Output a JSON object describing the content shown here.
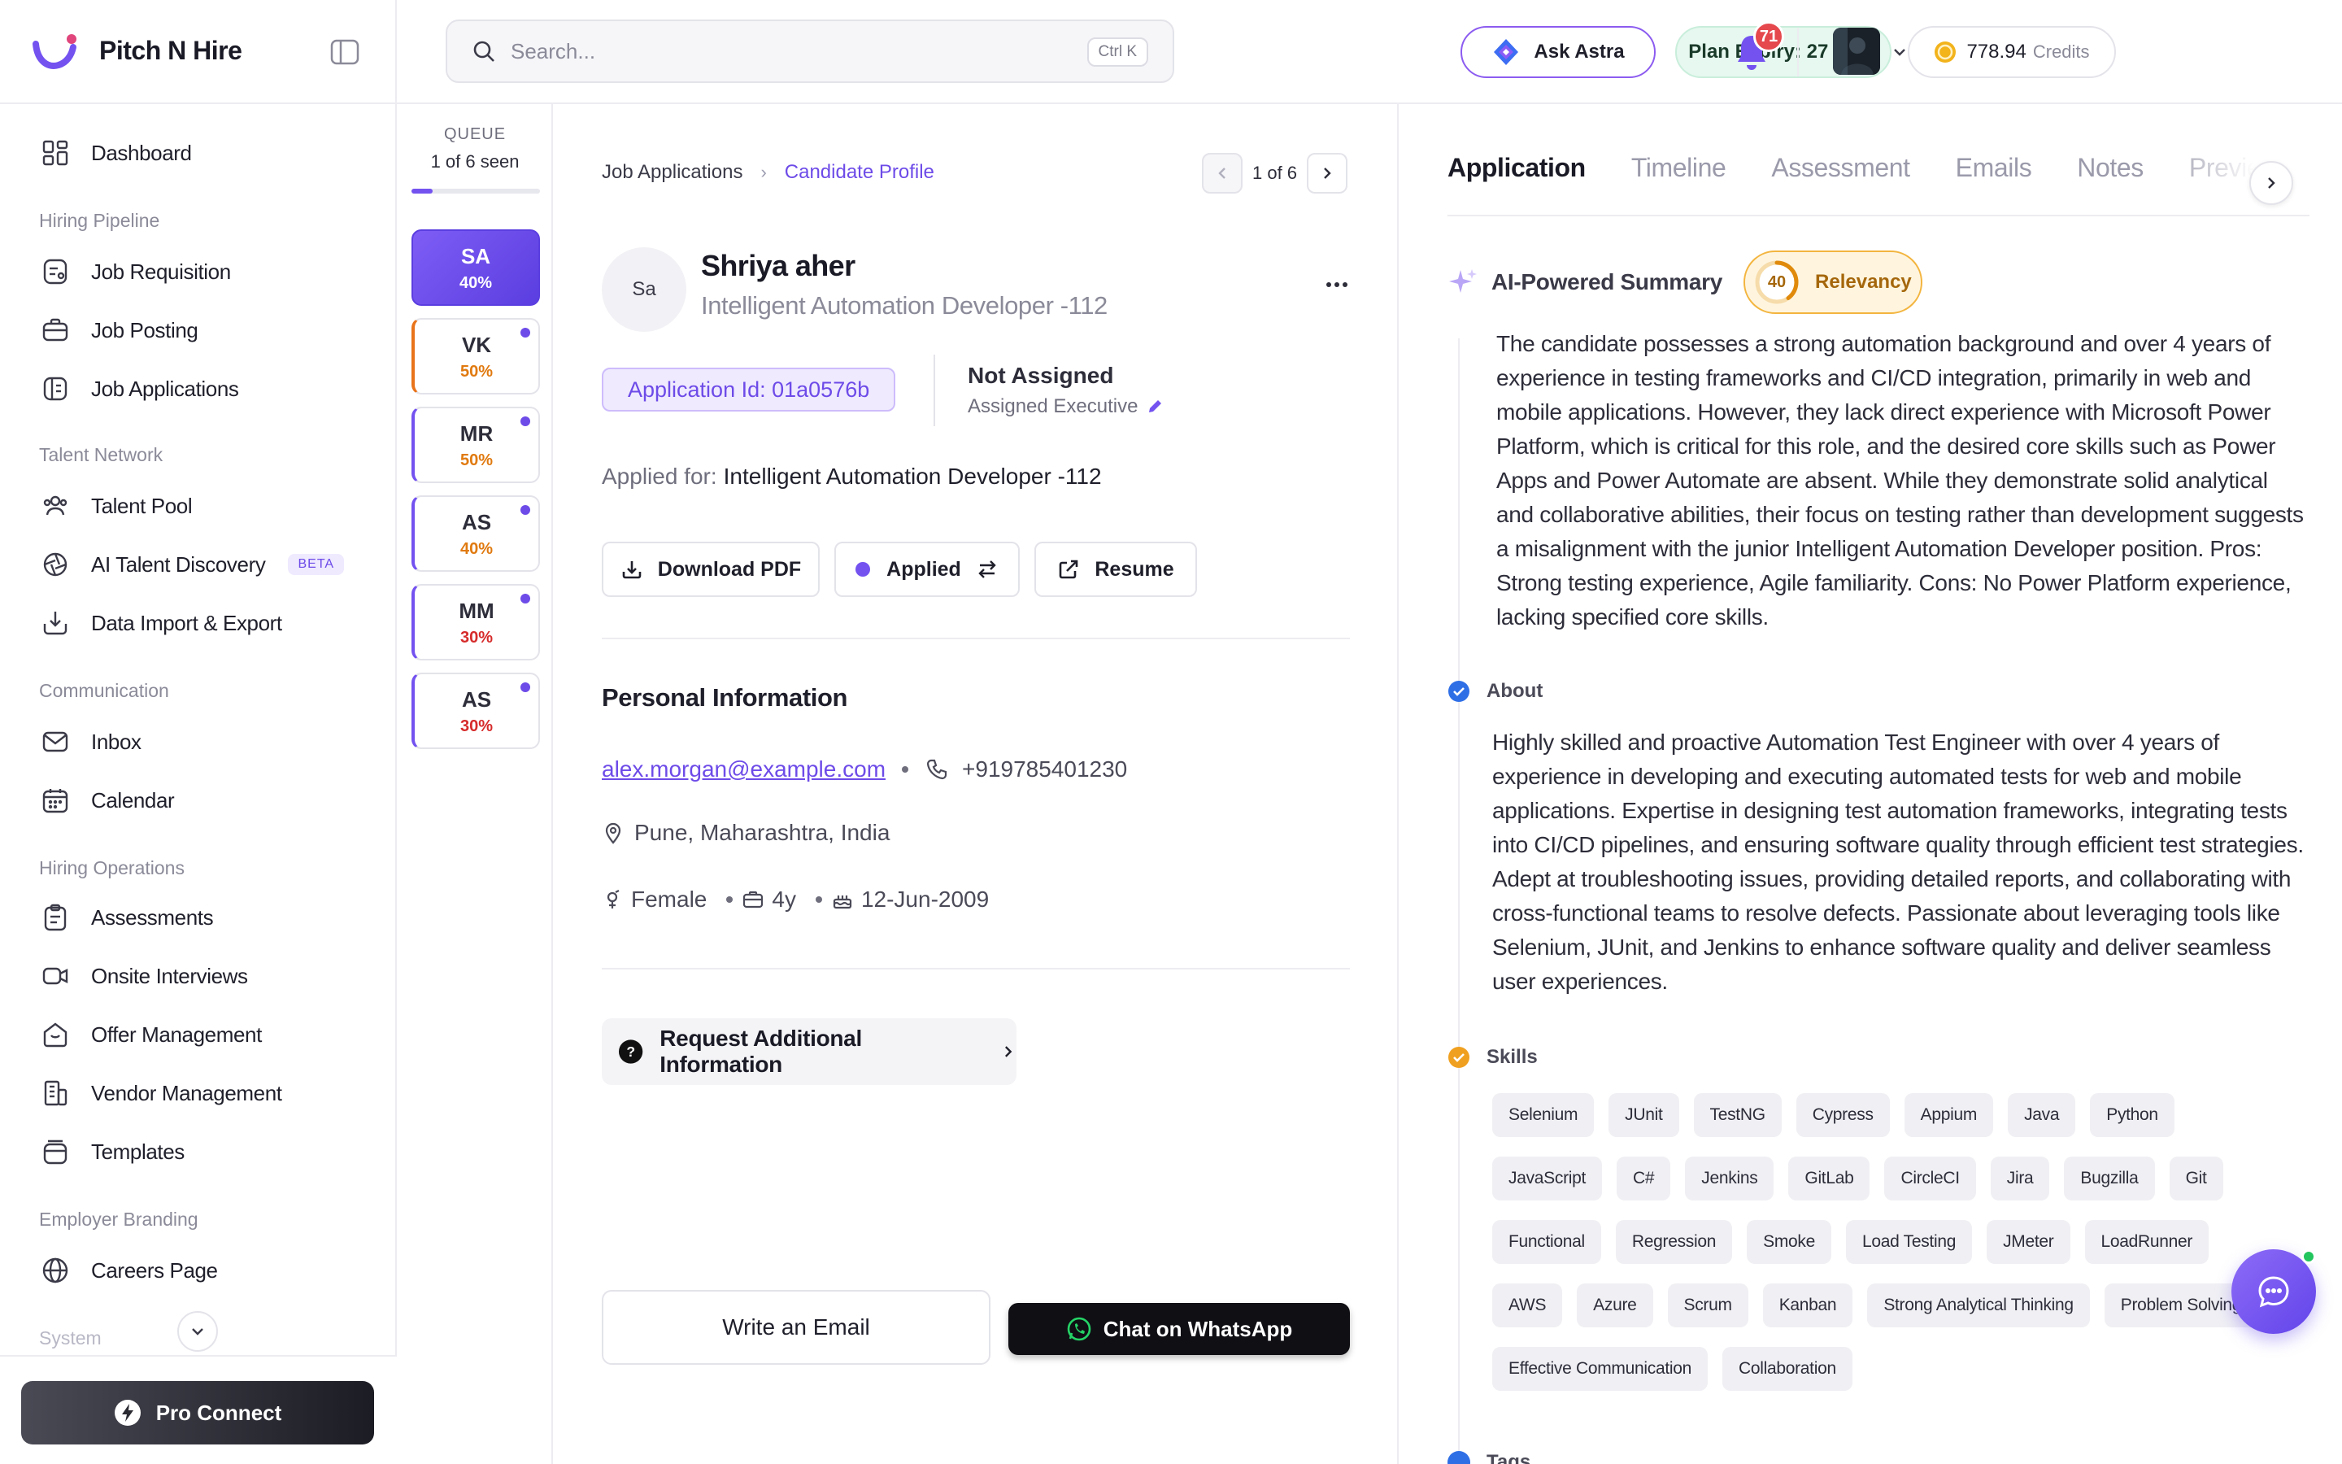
{
  "brand": {
    "name": "Pitch N Hire",
    "accent": "#6d4be8"
  },
  "sidebar": {
    "sections": {
      "hiring_pipeline": "Hiring Pipeline",
      "talent_network": "Talent Network",
      "communication": "Communication",
      "hiring_operations": "Hiring Operations",
      "employer_branding": "Employer Branding",
      "system": "System"
    },
    "items": {
      "dashboard": "Dashboard",
      "job_requisition": "Job Requisition",
      "job_posting": "Job Posting",
      "job_applications": "Job Applications",
      "talent_pool": "Talent Pool",
      "ai_talent_discovery": "AI Talent Discovery",
      "beta": "BETA",
      "data_import_export": "Data Import & Export",
      "inbox": "Inbox",
      "calendar": "Calendar",
      "assessments": "Assessments",
      "onsite_interviews": "Onsite Interviews",
      "offer_management": "Offer Management",
      "vendor_management": "Vendor Management",
      "templates": "Templates",
      "careers_page": "Careers Page"
    },
    "pro_connect": "Pro Connect"
  },
  "topbar": {
    "search_placeholder": "Search...",
    "search_shortcut": "Ctrl K",
    "ask_astra": "Ask Astra",
    "plan_expiry": "Plan Expiry: 27 days",
    "credits_value": "778.94",
    "credits_unit": "Credits",
    "notifications": "71"
  },
  "queue": {
    "title": "QUEUE",
    "seen": "1 of 6 seen",
    "progress": 0.1667,
    "items": [
      {
        "initials": "SA",
        "score": "40%",
        "color": "#ffffff",
        "active": true,
        "unread": false,
        "edge": ""
      },
      {
        "initials": "VK",
        "score": "50%",
        "color": "#e07a10",
        "active": false,
        "unread": true,
        "edge": "#e8731a"
      },
      {
        "initials": "MR",
        "score": "50%",
        "color": "#e07a10",
        "active": false,
        "unread": true,
        "edge": "#7352f0"
      },
      {
        "initials": "AS",
        "score": "40%",
        "color": "#e07a10",
        "active": false,
        "unread": true,
        "edge": "#7352f0"
      },
      {
        "initials": "MM",
        "score": "30%",
        "color": "#d62b2b",
        "active": false,
        "unread": true,
        "edge": "#7352f0"
      },
      {
        "initials": "AS",
        "score": "30%",
        "color": "#d62b2b",
        "active": false,
        "unread": true,
        "edge": "#7352f0"
      }
    ]
  },
  "breadcrumb": {
    "parent": "Job Applications",
    "current": "Candidate Profile"
  },
  "pager": {
    "text": "1 of 6"
  },
  "candidate": {
    "initials": "Sa",
    "name": "Shriya aher",
    "role": "Intelligent Automation Developer -112",
    "application_id": "Application Id: 01a0576b",
    "assignee": "Not Assigned",
    "assignee_label": "Assigned Executive",
    "applied_for_label": "Applied for:",
    "applied_for": "Intelligent Automation Developer -112"
  },
  "actions": {
    "download_pdf": "Download PDF",
    "status": "Applied",
    "resume": "Resume",
    "request_info": "Request Additional Information",
    "write_email": "Write an Email",
    "whatsapp": "Chat on WhatsApp"
  },
  "personal": {
    "title": "Personal Information",
    "email": "alex.morgan@example.com",
    "phone": "+919785401230",
    "location": "Pune, Maharashtra, India",
    "gender": "Female",
    "experience": "4y",
    "dob": "12-Jun-2009"
  },
  "tabs": [
    "Application",
    "Timeline",
    "Assessment",
    "Emails",
    "Notes",
    "Preview"
  ],
  "ai": {
    "title": "AI-Powered Summary",
    "relevancy_score": 40,
    "relevancy_label": "Relevancy",
    "summary": "The candidate possesses a strong automation background and over 4 years of experience in testing frameworks and CI/CD integration, primarily in web and mobile applications. However, they lack direct experience with Microsoft Power Platform, which is critical for this role, and the desired core skills such as Power Apps and Power Automate are absent. While they demonstrate solid analytical and collaborative abilities, their focus on testing rather than development suggests a misalignment with the junior Intelligent Automation Developer position. Pros: Strong testing experience, Agile familiarity. Cons: No Power Platform experience, lacking specified core skills."
  },
  "about": {
    "title": "About",
    "text": "Highly skilled and proactive Automation Test Engineer with over 4 years of experience in developing and executing automated tests for web and mobile applications. Expertise in designing test automation frameworks, integrating tests into CI/CD pipelines, and ensuring software quality through efficient test strategies. Adept at troubleshooting issues, providing detailed reports, and collaborating with cross-functional teams to resolve defects. Passionate about leveraging tools like Selenium, JUnit, and Jenkins to enhance software quality and deliver seamless user experiences."
  },
  "skills": {
    "title": "Skills",
    "items": [
      "Selenium",
      "JUnit",
      "TestNG",
      "Cypress",
      "Appium",
      "Java",
      "Python",
      "JavaScript",
      "C#",
      "Jenkins",
      "GitLab",
      "CircleCI",
      "Jira",
      "Bugzilla",
      "Git",
      "Functional",
      "Regression",
      "Smoke",
      "Load Testing",
      "JMeter",
      "LoadRunner",
      "AWS",
      "Azure",
      "Scrum",
      "Kanban",
      "Strong Analytical Thinking",
      "Problem Solving",
      "Effective Communication",
      "Collaboration"
    ]
  },
  "tags": {
    "title": "Tags"
  }
}
